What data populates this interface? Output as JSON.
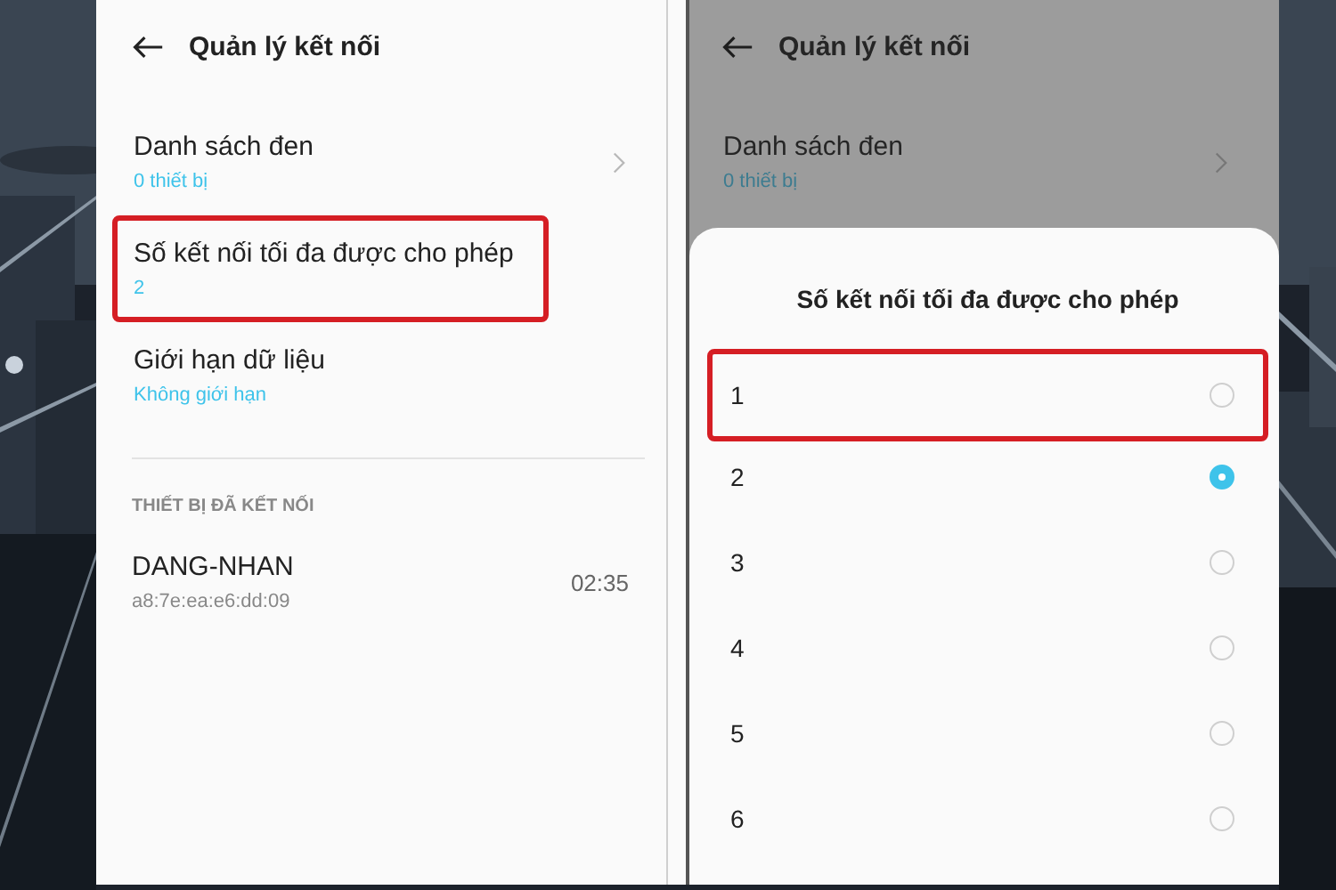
{
  "left_screen": {
    "title": "Quản lý kết nối",
    "items": [
      {
        "title": "Danh sách đen",
        "subtitle": "0 thiết bị",
        "chevron": true,
        "highlighted": false
      },
      {
        "title": "Số kết nối tối đa được cho phép",
        "subtitle": "2",
        "chevron": false,
        "highlighted": true
      },
      {
        "title": "Giới hạn dữ liệu",
        "subtitle": "Không giới hạn",
        "chevron": false,
        "highlighted": false
      }
    ],
    "section_header": "THIẾT BỊ ĐÃ KẾT NỐI",
    "devices": [
      {
        "name": "DANG-NHAN",
        "address": "a8:7e:ea:e6:dd:09",
        "time": "02:35"
      }
    ]
  },
  "right_screen": {
    "title": "Quản lý kết nối",
    "items": [
      {
        "title": "Danh sách đen",
        "subtitle": "0 thiết bị",
        "chevron": true
      }
    ],
    "sheet": {
      "title": "Số kết nối tối đa được cho phép",
      "options": [
        {
          "label": "1",
          "selected": false,
          "highlighted": true
        },
        {
          "label": "2",
          "selected": true,
          "highlighted": false
        },
        {
          "label": "3",
          "selected": false,
          "highlighted": false
        },
        {
          "label": "4",
          "selected": false,
          "highlighted": false
        },
        {
          "label": "5",
          "selected": false,
          "highlighted": false
        },
        {
          "label": "6",
          "selected": false,
          "highlighted": false
        }
      ]
    }
  }
}
